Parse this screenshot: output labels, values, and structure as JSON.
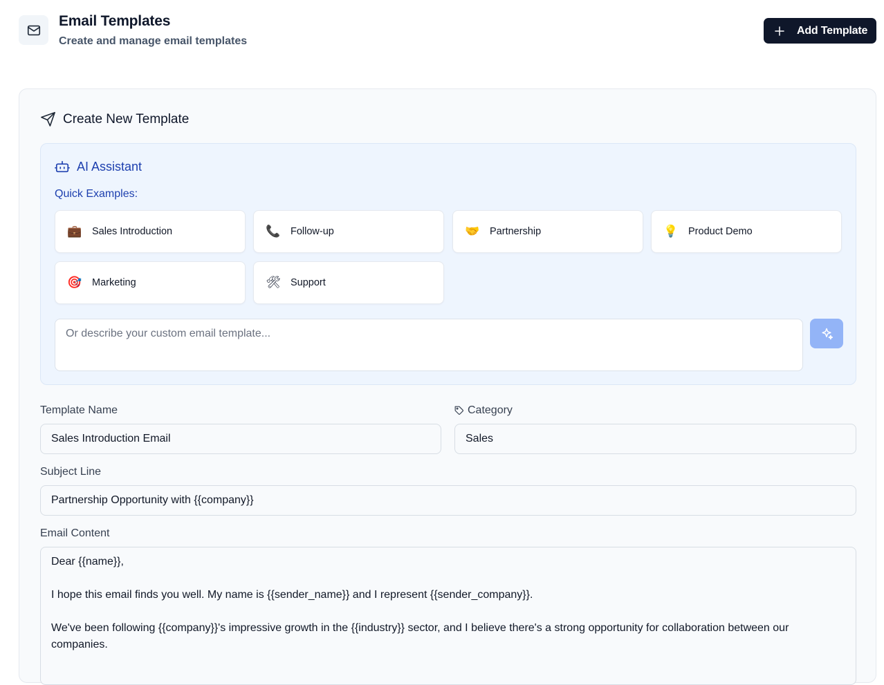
{
  "header": {
    "title": "Email Templates",
    "subtitle": "Create and manage email templates",
    "add_button_label": "Add Template"
  },
  "create_card": {
    "title": "Create New Template"
  },
  "ai_assistant": {
    "title": "AI Assistant",
    "quick_examples_label": "Quick Examples:",
    "examples": [
      {
        "label": "Sales Introduction",
        "emoji": "💼"
      },
      {
        "label": "Follow-up",
        "emoji": "📞"
      },
      {
        "label": "Partnership",
        "emoji": "🤝"
      },
      {
        "label": "Product Demo",
        "emoji": "💡"
      },
      {
        "label": "Marketing",
        "emoji": "🎯"
      },
      {
        "label": "Support",
        "emoji": "🛠"
      }
    ],
    "custom_placeholder": "Or describe your custom email template..."
  },
  "form": {
    "template_name_label": "Template Name",
    "template_name_value": "Sales Introduction Email",
    "category_label": "Category",
    "category_value": "Sales",
    "subject_label": "Subject Line",
    "subject_value": "Partnership Opportunity with {{company}}",
    "content_label": "Email Content",
    "content_value": "Dear {{name}},\n\nI hope this email finds you well. My name is {{sender_name}} and I represent {{sender_company}}.\n\nWe've been following {{company}}'s impressive growth in the {{industry}} sector, and I believe there's a strong opportunity for collaboration between our companies."
  },
  "colors": {
    "primary_dark": "#0f172a",
    "ai_accent": "#1e40af",
    "ai_panel_bg": "#eef5fe",
    "generate_button": "#93b4f7"
  }
}
